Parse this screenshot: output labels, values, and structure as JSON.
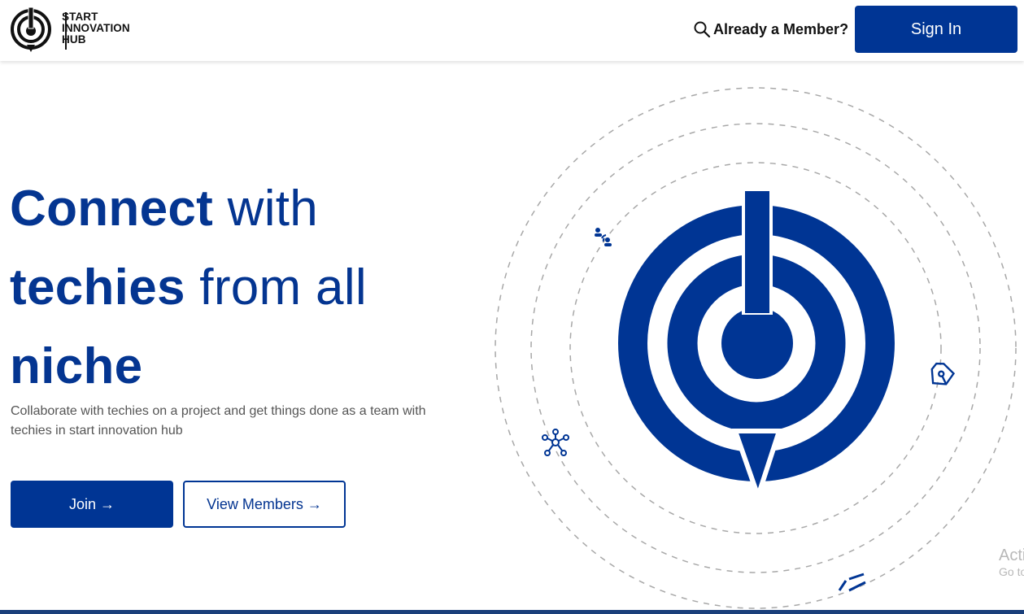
{
  "header": {
    "logo_lines": [
      "START",
      "INNOVATION",
      "HUB"
    ],
    "member_link": "Already a Member?",
    "signin_label": "Sign In"
  },
  "hero": {
    "headline": {
      "w1": "Connect",
      "w2": " with",
      "w3": "techies",
      "w4": " from all",
      "w5": "niche"
    },
    "subtitle": "Collaborate with techies on a project and get things done as a team with techies in start innovation hub",
    "join_label": "Join →",
    "view_label": "View Members →"
  },
  "watermark": {
    "line1": "Activate Windows",
    "line2": "Go to Settings to activate Windows."
  },
  "colors": {
    "brand": "#003594",
    "text_dark": "#111111",
    "text_muted": "#555555"
  },
  "icons": [
    "search-icon",
    "people-network-icon",
    "pen-nib-icon",
    "molecule-icon",
    "arrow-right-icon"
  ]
}
